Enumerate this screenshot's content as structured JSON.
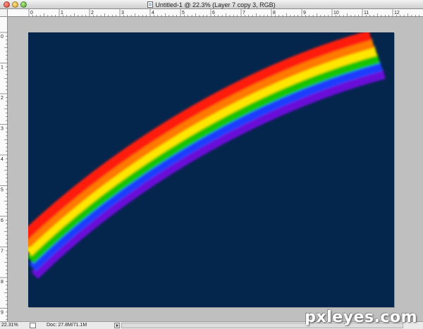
{
  "window": {
    "title": "Untitled-1 @ 22.3% (Layer 7 copy 3, RGB)"
  },
  "rulers": {
    "horizontal_labels": [
      "0",
      "1",
      "2",
      "3",
      "4",
      "5",
      "6",
      "7",
      "8",
      "9",
      "10",
      "11",
      "12"
    ],
    "vertical_labels": [
      "0",
      "1",
      "2",
      "3",
      "4",
      "5",
      "6",
      "7",
      "8",
      "9"
    ]
  },
  "canvas": {
    "background_color": "#04264d",
    "rainbow_colors": [
      "#ff1c10",
      "#ff7a00",
      "#ffe600",
      "#16c400",
      "#1a3cff",
      "#6a10d8"
    ]
  },
  "status": {
    "zoom": "22.31%",
    "doc_size": "Doc: 27.8M/71.1M"
  },
  "watermark": "pxleyes.com"
}
